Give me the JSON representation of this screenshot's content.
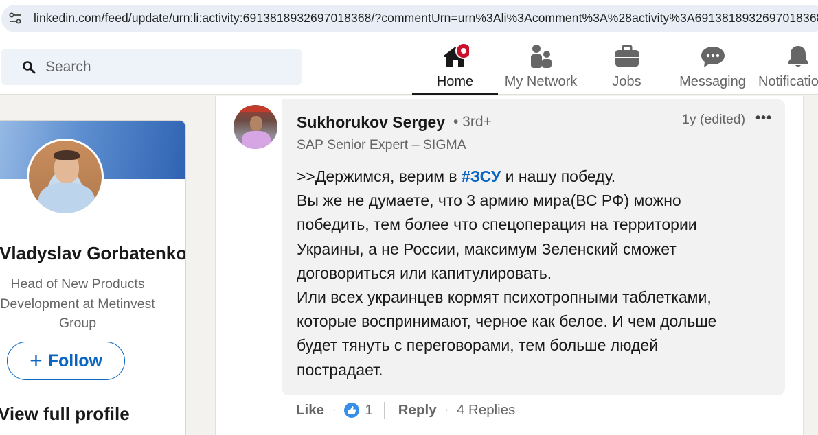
{
  "browser": {
    "url": "linkedin.com/feed/update/urn:li:activity:6913818932697018368/?commentUrn=urn%3Ali%3Acomment%3A%28activity%3A6913818932697018368%"
  },
  "nav": {
    "search_placeholder": "Search",
    "items": [
      {
        "label": "Home"
      },
      {
        "label": "My Network"
      },
      {
        "label": "Jobs"
      },
      {
        "label": "Messaging"
      },
      {
        "label": "Notifications"
      }
    ]
  },
  "profile": {
    "name": "Vladyslav Gorbatenko",
    "headline": "Head of New Products Development at Metinvest Group",
    "follow_label": "Follow",
    "view_profile_label": "View full profile"
  },
  "comment": {
    "author": "Sukhorukov Sergey",
    "degree": "• 3rd+",
    "headline": "SAP Senior Expert – SIGMA",
    "time": "1y (edited)",
    "more": "•••",
    "text_parts": {
      "l1_before": ">>Держимся, верим в ",
      "l1_hashtag": "#ЗСУ",
      "l1_after": " и нашу победу.",
      "l2": "Вы же не думаете, что 3 армию мира(ВС РФ) можно",
      "l3": "победить, тем более что спецоперация на территории",
      "l4": "Украины, а не России, максимум Зеленский сможет",
      "l5": "договориться или капитулировать.",
      "l6": "Или всех украинцев кормят психотропными таблетками,",
      "l7": "которые воспринимают, черное как белое. И чем дольше",
      "l8": "будет тянуть с переговорами, тем больше людей",
      "l9": "пострадает."
    },
    "actions": {
      "like": "Like",
      "dot": "·",
      "reaction_count": "1",
      "reply": "Reply",
      "replies": "4 Replies"
    }
  },
  "colors": {
    "linkedin_blue": "#0a66c2",
    "notification_badge": "#cb112d"
  }
}
